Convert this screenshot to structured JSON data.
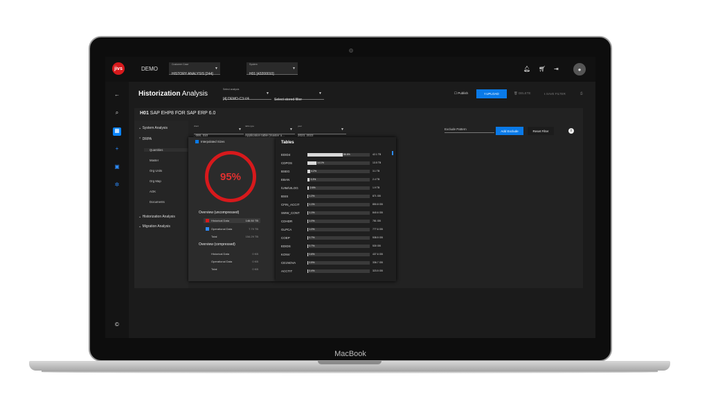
{
  "device_label": "MacBook",
  "topbar": {
    "logo": "jivs",
    "workspace": "DEMO",
    "customer_case": {
      "label": "Customer Case",
      "value": "HISTORY ANALYSIS [244]"
    },
    "system": {
      "label": "System",
      "value": "H01 [43200010]"
    },
    "icons": [
      "bell-icon",
      "cart-icon",
      "logout-icon",
      "user-icon"
    ]
  },
  "header": {
    "title_bold": "Historization",
    "title_light": "Analysis",
    "select_analysis": {
      "label": "Select analysis",
      "value": "[4] DEMO-C3-V4"
    },
    "stored_filter": {
      "placeholder": "Select stored filter"
    },
    "publish": "Publish",
    "upload": "UPLOAD",
    "delete": "DELETE",
    "save_filter": "SAVE FILTER"
  },
  "card": {
    "system_code": "H01",
    "system_name": "SAP EHP8 FOR SAP ERP 6.0"
  },
  "nav": {
    "system_analysis": "System Analysis",
    "drpa": "DRPA",
    "subitems": [
      "Quantities",
      "Master",
      "Org Units",
      "Org Map",
      "AOK",
      "Documents"
    ],
    "historization_analysis": "Historization Analysis",
    "migration_analysis": "Migration Analysis"
  },
  "filters": {
    "client": {
      "label": "client",
      "value": ", 000, 310"
    },
    "table_type": {
      "label": "table type",
      "value": "Application table (master a..."
    },
    "year": {
      "label": "year",
      "value": "2023, 2022"
    },
    "exclude_pattern": "Exclude Pattern",
    "add_exclude": "Add Exclude",
    "reset_filter": "Reset Filter"
  },
  "overview": {
    "interpolated": "Interpolated Sizes",
    "percent": "95%",
    "uncompressed_title": "Overview (uncompressed)",
    "uncompressed": [
      {
        "label": "Historical Data",
        "value": "146.50 TB"
      },
      {
        "label": "Operational Data",
        "value": "7.79 TB"
      },
      {
        "label": "Total",
        "value": "154.29 TB"
      }
    ],
    "compressed_title": "Overview (compressed)",
    "compressed": [
      {
        "label": "Historical Data",
        "value": "0 KB"
      },
      {
        "label": "Operational Data",
        "value": "0 KB"
      },
      {
        "label": "Total",
        "value": "0 KB"
      }
    ],
    "colors": {
      "historical": "#d7191c",
      "operational": "#2d8cff"
    }
  },
  "tables": {
    "title": "Tables",
    "rows": [
      {
        "name": "EDID4",
        "pct": 56.6,
        "pct_label": "56.6%",
        "size": "42.1 TB"
      },
      {
        "name": "CDPOS",
        "pct": 14.1,
        "pct_label": "14.1%",
        "size": "13.5 TB"
      },
      {
        "name": "BSEG",
        "pct": 4.2,
        "pct_label": "4.2%",
        "size": "3.1 TB"
      },
      {
        "name": "EBAN",
        "pct": 3.3,
        "pct_label": "3.3%",
        "size": "2.4 TB"
      },
      {
        "name": "/UIM/UILOG",
        "pct": 2.6,
        "pct_label": "2.6%",
        "size": "1.9 TB"
      },
      {
        "name": "BSIS",
        "pct": 1.2,
        "pct_label": "1.2%",
        "size": "871 GB"
      },
      {
        "name": "CFIN_ACCIT",
        "pct": 1.1,
        "pct_label": "1.1%",
        "size": "850.8 GB"
      },
      {
        "name": "SWW_CONT",
        "pct": 1.1,
        "pct_label": "1.1%",
        "size": "840.6 GB"
      },
      {
        "name": "CDHDR",
        "pct": 1.0,
        "pct_label": "1.0%",
        "size": "781 GB"
      },
      {
        "name": "GLPCA",
        "pct": 1.0,
        "pct_label": "1.0%",
        "size": "777.6 GB"
      },
      {
        "name": "COEP",
        "pct": 0.7,
        "pct_label": "0.7%",
        "size": "538.5 GB"
      },
      {
        "name": "EDIDS",
        "pct": 0.7,
        "pct_label": "0.7%",
        "size": "530 GB"
      },
      {
        "name": "KONV",
        "pct": 0.6,
        "pct_label": "0.6%",
        "size": "437.6 GB"
      },
      {
        "name": "CE1NOVA",
        "pct": 0.5,
        "pct_label": "0.5%",
        "size": "336.7 GB"
      },
      {
        "name": "ACCTIT",
        "pct": 0.4,
        "pct_label": "0.4%",
        "size": "323.5 GB"
      }
    ]
  }
}
